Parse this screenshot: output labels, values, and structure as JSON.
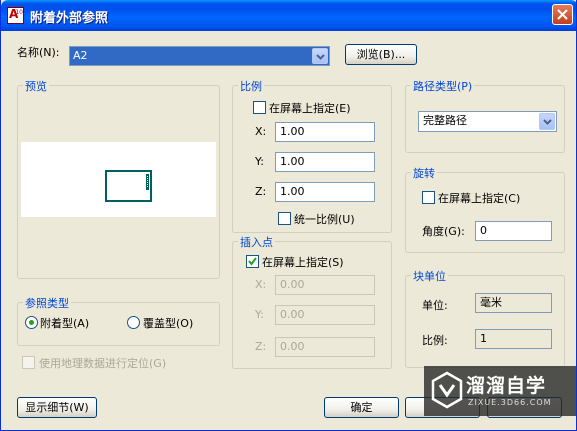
{
  "window": {
    "title": "附着外部参照",
    "icon_text": "A",
    "icon_subtext": "10",
    "close": "close"
  },
  "name_row": {
    "label": "名称(N):",
    "value": "A2",
    "browse": "浏览(B)..."
  },
  "preview": {
    "label": "预览"
  },
  "ref_type": {
    "label": "参照类型",
    "options": [
      "附着型(A)",
      "覆盖型(O)"
    ],
    "selected": "附着型(A)"
  },
  "geo": {
    "label": "使用地理数据进行定位(G)"
  },
  "scale": {
    "label": "比例",
    "on_screen": "在屏幕上指定(E)",
    "x_label": "X:",
    "x": "1.00",
    "y_label": "Y:",
    "y": "1.00",
    "z_label": "Z:",
    "z": "1.00",
    "uniform": "统一比例(U)"
  },
  "insert_point": {
    "label": "插入点",
    "on_screen": "在屏幕上指定(S)",
    "x_label": "X:",
    "x": "0.00",
    "y_label": "Y:",
    "y": "0.00",
    "z_label": "Z:",
    "z": "0.00"
  },
  "path_type": {
    "label": "路径类型(P)",
    "value": "完整路径"
  },
  "rotation": {
    "label": "旋转",
    "on_screen": "在屏幕上指定(C)",
    "angle_label": "角度(G):",
    "angle": "0"
  },
  "block_unit": {
    "label": "块单位",
    "unit_label": "单位:",
    "unit": "毫米",
    "ratio_label": "比例:",
    "ratio": "1"
  },
  "buttons": {
    "details": "显示细节(W)",
    "ok": "确定"
  },
  "watermark": {
    "text": "溜溜自学",
    "url": "ZIXUE.3D66.COM"
  },
  "colors": {
    "accent_label": "#0046d5",
    "title_bar": "#0054e3",
    "selection": "#316ac5",
    "preview_frame": "#006060"
  }
}
